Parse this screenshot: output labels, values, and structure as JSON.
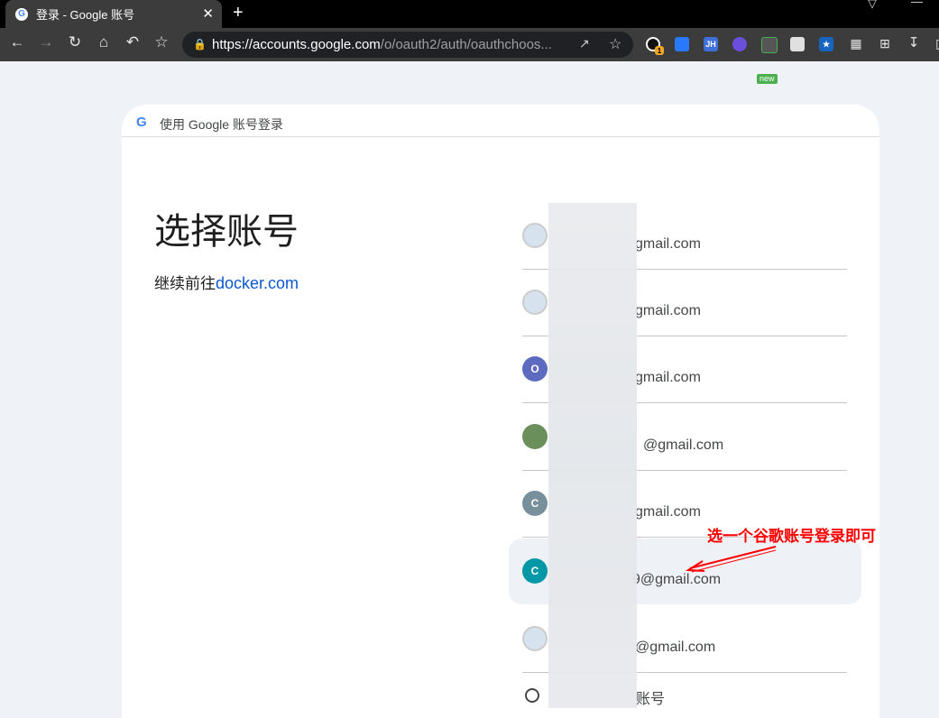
{
  "browser": {
    "tab_title": "登录 - Google 账号",
    "url_domain": "https://accounts.google.com",
    "url_path": "/o/oauth2/auth/oauthchoos...",
    "new_tab": "+",
    "tab_close": "✕",
    "ext_jh": "JH",
    "ext_badge": "1",
    "ext_new": "new"
  },
  "card": {
    "header": "使用 Google 账号登录",
    "title": "选择账号",
    "continue_prefix": "继续前往",
    "continue_link": "docker.com",
    "accounts": [
      {
        "initial": "",
        "email": "gmail.com",
        "color": "#d6e3ee"
      },
      {
        "initial": "",
        "email": "gmail.com",
        "color": "#d6e3ee"
      },
      {
        "initial": "O",
        "email": "gmail.com",
        "color": "#5c6bc0"
      },
      {
        "initial": "",
        "email": "@gmail.com",
        "color": "#6a8f5a"
      },
      {
        "initial": "C",
        "email": "gmail.com",
        "color": "#78909c"
      },
      {
        "initial": "C",
        "email": "9@gmail.com",
        "color": "#0097a7"
      },
      {
        "initial": "",
        "email": "@gmail.com",
        "color": "#d6e3ee"
      }
    ],
    "use_other": "账号"
  },
  "annotation": {
    "text": "选一个谷歌账号登录即可",
    "color": "#ff0000"
  }
}
